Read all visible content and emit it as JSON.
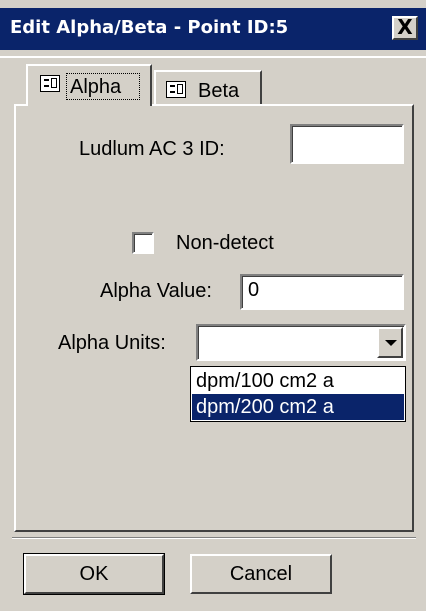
{
  "window": {
    "title": "Edit Alpha/Beta - Point ID:5",
    "close_label": "X"
  },
  "tabs": [
    {
      "label": "Alpha",
      "icon": "form-icon",
      "selected": true
    },
    {
      "label": "Beta",
      "icon": "form-icon",
      "selected": false
    }
  ],
  "form": {
    "ludlum_label": "Ludlum AC 3  ID:",
    "ludlum_value": "",
    "nondetect_label": "Non-detect",
    "nondetect_checked": false,
    "alpha_value_label": "Alpha Value:",
    "alpha_value": "0",
    "alpha_units_label": "Alpha Units:",
    "alpha_units_value": "",
    "alpha_units_options": [
      "dpm/100 cm2 a",
      "dpm/200 cm2 a"
    ],
    "alpha_units_highlighted": "dpm/200 cm2 a"
  },
  "buttons": {
    "ok": "OK",
    "cancel": "Cancel"
  },
  "colors": {
    "titlebar": "#0a246a",
    "face": "#d4d0c8",
    "highlight": "#0a246a"
  }
}
